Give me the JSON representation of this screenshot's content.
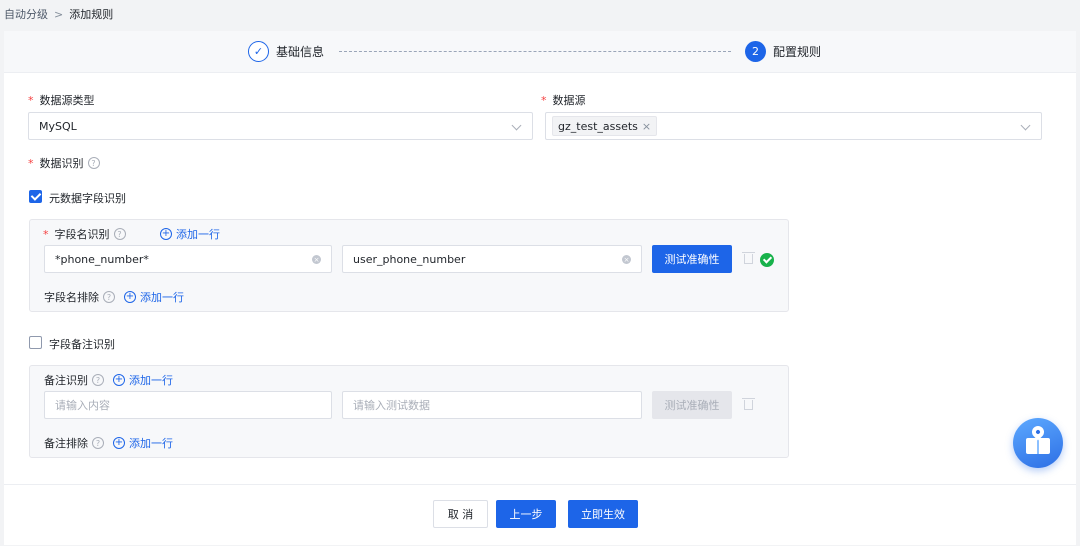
{
  "breadcrumb": {
    "parent": "自动分级",
    "separator": ">",
    "current": "添加规则"
  },
  "steps": [
    {
      "number": "1",
      "label": "基础信息",
      "status": "done"
    },
    {
      "number": "2",
      "label": "配置规则",
      "status": "active"
    }
  ],
  "form": {
    "datasource_type": {
      "label": "数据源类型",
      "value": "MySQL"
    },
    "datasource": {
      "label": "数据源",
      "tag": "gz_test_assets",
      "tag_close": "×"
    },
    "recognition": {
      "label": "数据识别"
    },
    "metadata": {
      "checkbox_label": "元数据字段识别",
      "checked": true,
      "field_label": "字段名识别",
      "add_row": "添加一行",
      "pattern_value": "*phone_number*",
      "test_value": "user_phone_number",
      "test_button": "测试准确性",
      "exclude_label": "字段名排除",
      "exclude_add": "添加一行"
    },
    "comment": {
      "checkbox_label": "字段备注识别",
      "checked": false,
      "field_label": "备注识别",
      "add_row": "添加一行",
      "content_placeholder": "请输入内容",
      "test_placeholder": "请输入测试数据",
      "test_button": "测试准确性",
      "exclude_label": "备注排除",
      "exclude_add": "添加一行"
    }
  },
  "footer": {
    "cancel": "取 消",
    "prev": "上一步",
    "submit": "立即生效"
  },
  "colors": {
    "primary": "#1d65e8",
    "success": "#18b24b",
    "required": "#f53f3f"
  }
}
